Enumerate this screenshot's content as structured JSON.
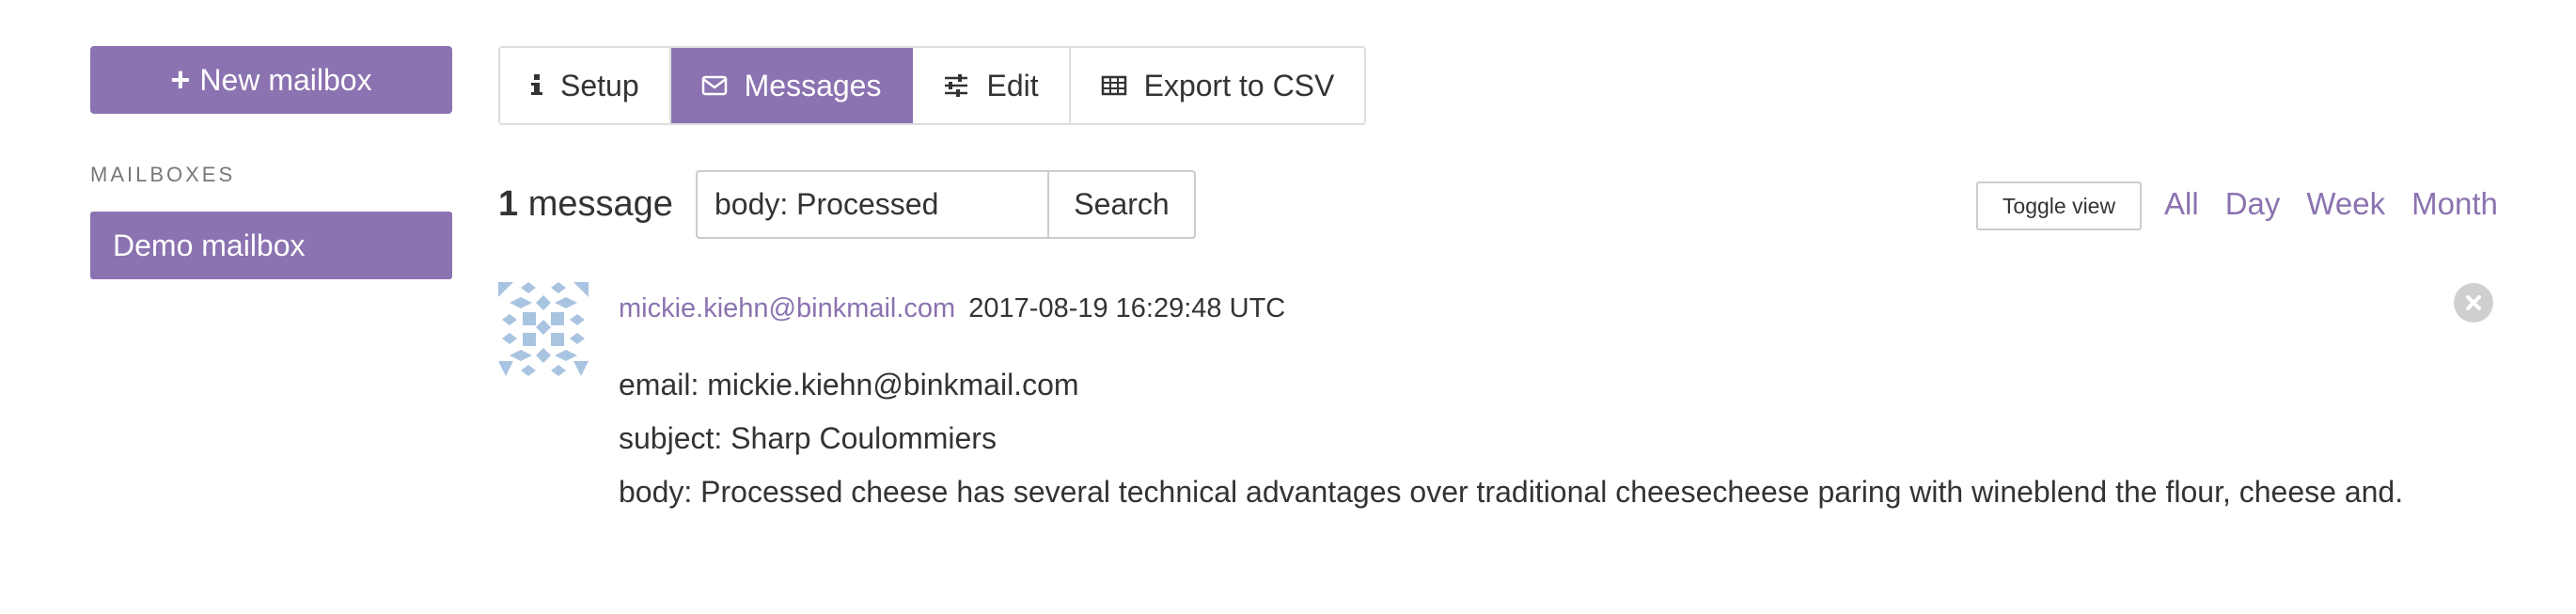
{
  "sidebar": {
    "new_mailbox_label": "New mailbox",
    "mailboxes_heading": "MAILBOXES",
    "mailboxes": [
      {
        "label": "Demo mailbox",
        "active": true
      }
    ]
  },
  "tabs": [
    {
      "label": "Setup",
      "icon": "info-icon",
      "active": false
    },
    {
      "label": "Messages",
      "icon": "envelope-icon",
      "active": true
    },
    {
      "label": "Edit",
      "icon": "sliders-icon",
      "active": false
    },
    {
      "label": "Export to CSV",
      "icon": "table-icon",
      "active": false
    }
  ],
  "toolbar": {
    "count_number": "1",
    "count_label": "message",
    "search_value": "body: Processed",
    "search_button": "Search",
    "toggle_view": "Toggle view",
    "ranges": [
      "All",
      "Day",
      "Week",
      "Month"
    ]
  },
  "message": {
    "from": "mickie.kiehn@binkmail.com",
    "date": "2017-08-19 16:29:48 UTC",
    "lines": [
      "email: mickie.kiehn@binkmail.com",
      "subject: Sharp Coulommiers",
      "body: Processed cheese has several technical advantages over traditional cheesecheese paring with wineblend the flour, cheese and."
    ]
  },
  "colors": {
    "accent": "#8b72b0",
    "avatar": "#a9c4e0",
    "border": "#dddddd"
  }
}
